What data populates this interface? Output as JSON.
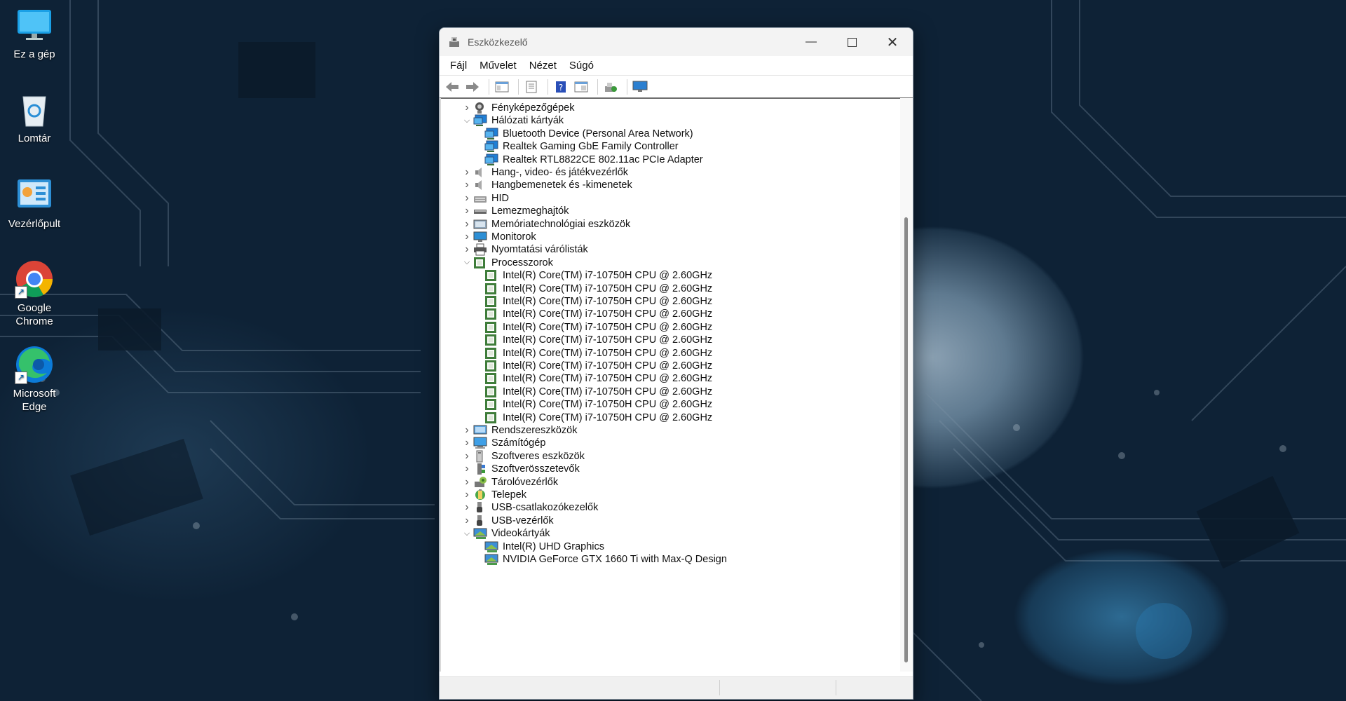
{
  "desktop": {
    "icons": [
      {
        "label": "Ez a gép",
        "icon": "monitor-icon"
      },
      {
        "label": "Lomtár",
        "icon": "recycle-bin-icon"
      },
      {
        "label": "Vezérlőpult",
        "icon": "control-panel-icon"
      },
      {
        "label": "Google Chrome",
        "icon": "chrome-icon"
      },
      {
        "label": "Microsoft Edge",
        "icon": "edge-icon"
      }
    ]
  },
  "window": {
    "title": "Eszközkezelő",
    "menu": [
      "Fájl",
      "Művelet",
      "Nézet",
      "Súgó"
    ]
  },
  "tree": [
    {
      "label": "Fényképezőgépek",
      "level": 0,
      "expanded": false,
      "icon": "camera-icon"
    },
    {
      "label": "Hálózati kártyák",
      "level": 0,
      "expanded": true,
      "icon": "network-icon"
    },
    {
      "label": "Bluetooth Device (Personal Area Network)",
      "level": 1,
      "icon": "network-icon"
    },
    {
      "label": "Realtek Gaming GbE Family Controller",
      "level": 1,
      "icon": "network-icon"
    },
    {
      "label": "Realtek RTL8822CE 802.11ac PCIe Adapter",
      "level": 1,
      "icon": "network-icon"
    },
    {
      "label": "Hang-, video- és játékvezérlők",
      "level": 0,
      "expanded": false,
      "icon": "speaker-icon"
    },
    {
      "label": "Hangbemenetek és -kimenetek",
      "level": 0,
      "expanded": false,
      "icon": "speaker-icon"
    },
    {
      "label": "HID",
      "level": 0,
      "expanded": false,
      "icon": "hid-icon"
    },
    {
      "label": "Lemezmeghajtók",
      "level": 0,
      "expanded": false,
      "icon": "disk-icon"
    },
    {
      "label": "Memóriatechnológiai eszközök",
      "level": 0,
      "expanded": false,
      "icon": "memory-icon"
    },
    {
      "label": "Monitorok",
      "level": 0,
      "expanded": false,
      "icon": "monitor-icon"
    },
    {
      "label": "Nyomtatási várólisták",
      "level": 0,
      "expanded": false,
      "icon": "printer-icon"
    },
    {
      "label": "Processzorok",
      "level": 0,
      "expanded": true,
      "icon": "cpu-icon"
    },
    {
      "label": "Intel(R) Core(TM) i7-10750H CPU @ 2.60GHz",
      "level": 1,
      "icon": "cpu-icon"
    },
    {
      "label": "Intel(R) Core(TM) i7-10750H CPU @ 2.60GHz",
      "level": 1,
      "icon": "cpu-icon"
    },
    {
      "label": "Intel(R) Core(TM) i7-10750H CPU @ 2.60GHz",
      "level": 1,
      "icon": "cpu-icon"
    },
    {
      "label": "Intel(R) Core(TM) i7-10750H CPU @ 2.60GHz",
      "level": 1,
      "icon": "cpu-icon"
    },
    {
      "label": "Intel(R) Core(TM) i7-10750H CPU @ 2.60GHz",
      "level": 1,
      "icon": "cpu-icon"
    },
    {
      "label": "Intel(R) Core(TM) i7-10750H CPU @ 2.60GHz",
      "level": 1,
      "icon": "cpu-icon"
    },
    {
      "label": "Intel(R) Core(TM) i7-10750H CPU @ 2.60GHz",
      "level": 1,
      "icon": "cpu-icon"
    },
    {
      "label": "Intel(R) Core(TM) i7-10750H CPU @ 2.60GHz",
      "level": 1,
      "icon": "cpu-icon"
    },
    {
      "label": "Intel(R) Core(TM) i7-10750H CPU @ 2.60GHz",
      "level": 1,
      "icon": "cpu-icon"
    },
    {
      "label": "Intel(R) Core(TM) i7-10750H CPU @ 2.60GHz",
      "level": 1,
      "icon": "cpu-icon"
    },
    {
      "label": "Intel(R) Core(TM) i7-10750H CPU @ 2.60GHz",
      "level": 1,
      "icon": "cpu-icon"
    },
    {
      "label": "Intel(R) Core(TM) i7-10750H CPU @ 2.60GHz",
      "level": 1,
      "icon": "cpu-icon"
    },
    {
      "label": "Rendszereszközök",
      "level": 0,
      "expanded": false,
      "icon": "system-icon"
    },
    {
      "label": "Számítógép",
      "level": 0,
      "expanded": false,
      "icon": "computer-icon"
    },
    {
      "label": "Szoftveres eszközök",
      "level": 0,
      "expanded": false,
      "icon": "software-device-icon"
    },
    {
      "label": "Szoftverösszetevők",
      "level": 0,
      "expanded": false,
      "icon": "component-icon"
    },
    {
      "label": "Tárolóvezérlők",
      "level": 0,
      "expanded": false,
      "icon": "storage-icon"
    },
    {
      "label": "Telepek",
      "level": 0,
      "expanded": false,
      "icon": "battery-icon"
    },
    {
      "label": "USB-csatlakozókezelők",
      "level": 0,
      "expanded": false,
      "icon": "usb-icon"
    },
    {
      "label": "USB-vezérlők",
      "level": 0,
      "expanded": false,
      "icon": "usb-icon"
    },
    {
      "label": "Videokártyák",
      "level": 0,
      "expanded": true,
      "icon": "display-adapter-icon"
    },
    {
      "label": "Intel(R) UHD Graphics",
      "level": 1,
      "icon": "display-adapter-icon"
    },
    {
      "label": "NVIDIA GeForce GTX 1660 Ti with Max-Q Design",
      "level": 1,
      "icon": "display-adapter-icon"
    }
  ],
  "colors": {
    "accent": "#1f6fd1",
    "cpu_green": "#3f7d3a"
  }
}
